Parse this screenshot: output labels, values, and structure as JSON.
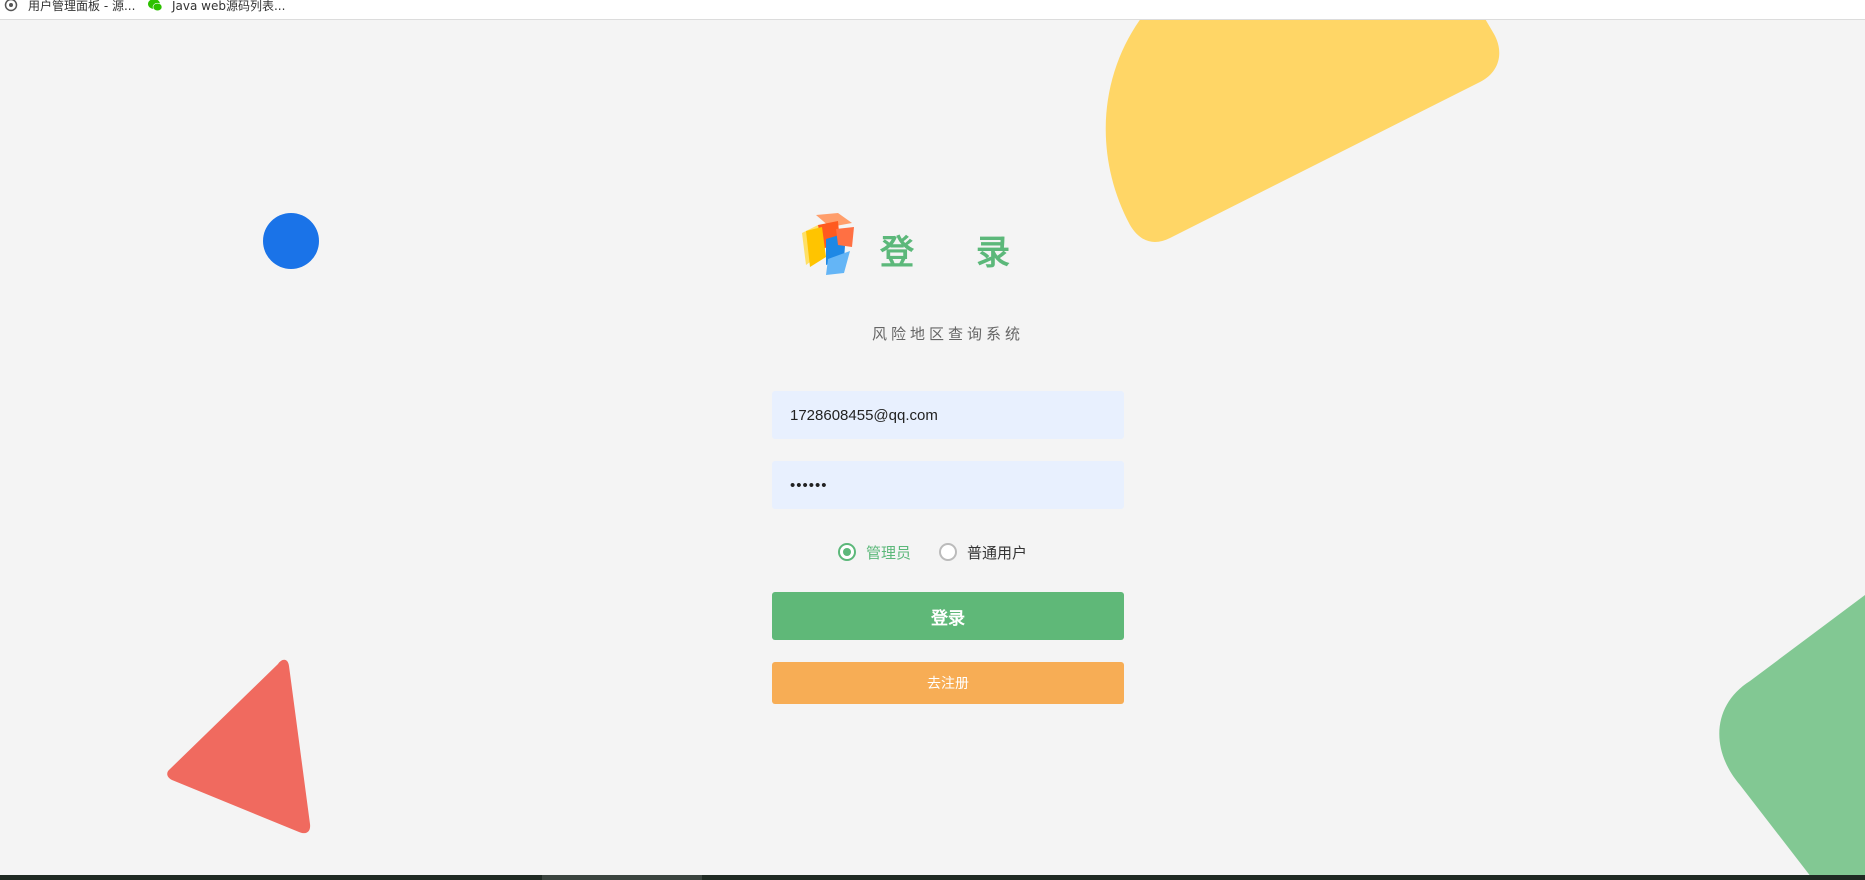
{
  "bookmarks": [
    {
      "label": "用户管理面板 - 源...",
      "icon": "page-icon"
    },
    {
      "label": "Java web源码列表...",
      "icon": "wechat-icon"
    }
  ],
  "login": {
    "title": "登录",
    "subtitle": "风险地区查询系统",
    "email_value": "1728608455@qq.com",
    "password_value": "••••••",
    "roles": [
      {
        "label": "管理员",
        "checked": true
      },
      {
        "label": "普通用户",
        "checked": false
      }
    ],
    "login_button": "登录",
    "register_button": "去注册"
  },
  "colors": {
    "accent_green": "#5cb87a",
    "register_orange": "#f7ad55",
    "input_bg": "#e8f0fe",
    "deco_yellow": "#ffd666",
    "deco_blue": "#1a73e8",
    "deco_red": "#f06a5f",
    "deco_green": "#82c893"
  }
}
